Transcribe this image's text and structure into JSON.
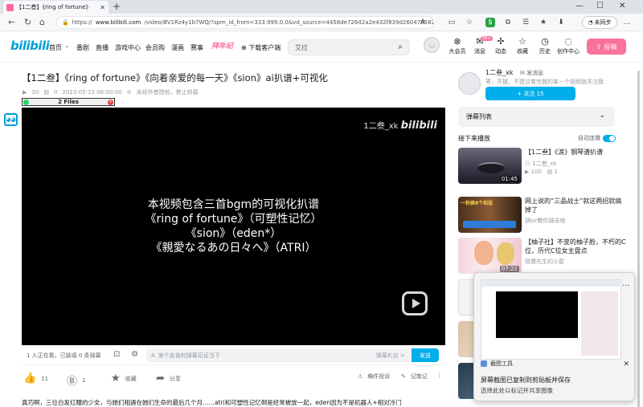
{
  "browser": {
    "tab_title": "【1二叁】《ring of fortune》",
    "url_prefix": "https://",
    "url_host": "www.bilibili.com",
    "url_path": "/video/BV1Rz4y1b7WQ/?spm_id_from=333.999.0.0&vd_source=4458de72642a2e432f839d2604785826",
    "sync_label": "未同步"
  },
  "header": {
    "logo": "bilibili",
    "nav": [
      "首页",
      "番剧",
      "直播",
      "游戏中心",
      "会员购",
      "漫画",
      "赛事"
    ],
    "promo": "拜年纪",
    "download": "下载客户端",
    "search_placeholder": "艾拉",
    "icons": [
      {
        "label": "大会员",
        "icon": "vip-icon"
      },
      {
        "label": "消息",
        "icon": "message-icon",
        "badge": "99+"
      },
      {
        "label": "动态",
        "icon": "dynamic-icon"
      },
      {
        "label": "收藏",
        "icon": "star-icon"
      },
      {
        "label": "历史",
        "icon": "clock-icon"
      },
      {
        "label": "创作中心",
        "icon": "bulb-icon"
      }
    ],
    "upload": "投稿"
  },
  "video": {
    "title": "【1二叁】《ring of fortune》《向着亲爱的每一天》《sion》ai扒谱+可视化",
    "plays": "20",
    "danmaku": "0",
    "date": "2023-05-22 06:00:00",
    "copyright": "未经作者授权，禁止转载",
    "files_label": "2 Files",
    "watermark_prefix": "1二叁_xk",
    "watermark_logo": "bilibili",
    "lyrics": [
      "本视频包含三首bgm的可视化扒谱",
      "《ring of fortune》（可塑性记忆）",
      "《sion》（eden*）",
      "《親愛なるあの日々へ》（ATRI）"
    ],
    "watching": "1 人正在看，已装填 0 条弹幕",
    "danmaku_placeholder": "发个友善的弹幕见证当下",
    "etiquette": "弹幕礼仪 >",
    "send": "发送",
    "likes": "11",
    "coins": "1",
    "fav": "收藏",
    "share": "分享",
    "report": "稿件投诉",
    "notes": "记笔记",
    "description": "真巧啊，三位白发红瞳的少女，与她们相遇在她们生命的最后几个月……atri和可塑性记忆倒是经常被放一起，eden因为不是机器人+相对冷门"
  },
  "uploader": {
    "name": "1二叁_xk",
    "message": "发消息",
    "sign": "寄，开摆，不建议看完我的某一个视频就关注我",
    "follow": "+ 关注 15"
  },
  "sidebar": {
    "danmaku_list": "弹幕列表",
    "next_up": "接下来播放",
    "autoplay": "自动连播",
    "recs": [
      {
        "title": "【1二叁】《涙》钢琴谱扒谱",
        "author": "1二叁_xk",
        "plays": "100",
        "dm": "1",
        "duration": "01:45"
      },
      {
        "title": "网上说的“三品战士”就这两招就搞掉了",
        "author": "胡sir教你弹吉他",
        "plays": "",
        "dm": "",
        "duration": ""
      },
      {
        "title": "【柚子社】不变的柚子脸，不朽的C位，历代C位女主盘点",
        "author": "晓儒先生的小屋",
        "plays": "",
        "dm": "",
        "duration": "07:22"
      }
    ]
  },
  "snip": {
    "app": "截图工具",
    "line1": "屏幕截图已复制到剪贴板并保存",
    "line2": "选择此处以标记并共享图像"
  }
}
